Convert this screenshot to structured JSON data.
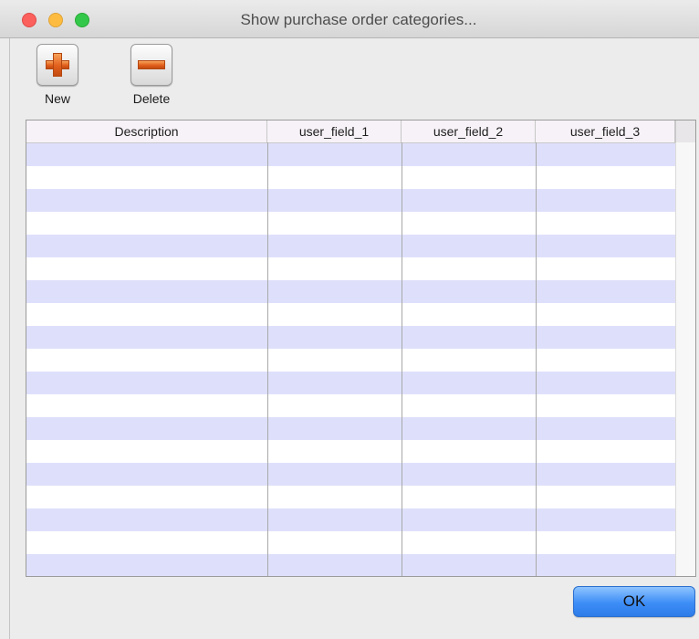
{
  "window": {
    "title": "Show purchase order categories..."
  },
  "toolbar": {
    "new_label": "New",
    "delete_label": "Delete"
  },
  "table": {
    "columns": [
      "Description",
      "user_field_1",
      "user_field_2",
      "user_field_3"
    ],
    "rows": []
  },
  "footer": {
    "ok_label": "OK"
  },
  "colors": {
    "row_stripe": "#dee0fb",
    "ok_button": "#3d8df7",
    "tool_icon": "#e2601d"
  },
  "icons": {
    "new": "plus-icon",
    "delete": "minus-icon"
  }
}
